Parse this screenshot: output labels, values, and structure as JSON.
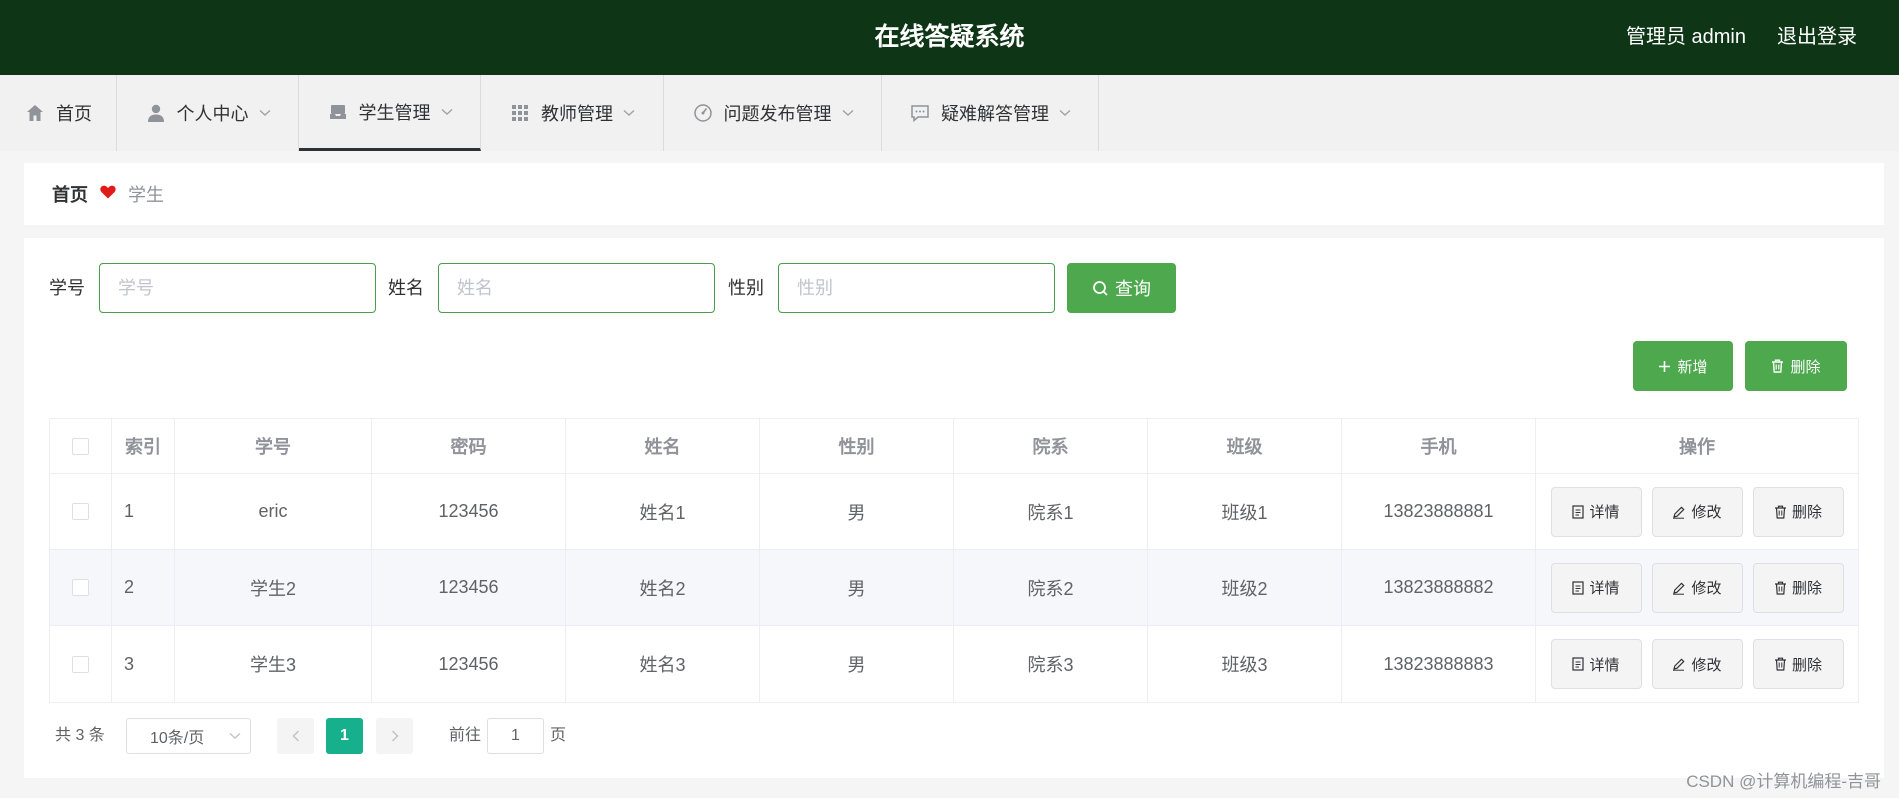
{
  "header": {
    "title": "在线答疑系统",
    "user": "管理员 admin",
    "logout": "退出登录"
  },
  "menu": [
    {
      "label": "首页",
      "icon": "home-icon"
    },
    {
      "label": "个人中心",
      "icon": "user-icon"
    },
    {
      "label": "学生管理",
      "icon": "inbox-icon",
      "active": true
    },
    {
      "label": "教师管理",
      "icon": "grid-icon"
    },
    {
      "label": "问题发布管理",
      "icon": "gauge-icon"
    },
    {
      "label": "疑难解答管理",
      "icon": "chat-icon"
    }
  ],
  "breadcrumb": {
    "home": "首页",
    "current": "学生"
  },
  "search": {
    "fields": [
      {
        "label": "学号",
        "placeholder": "学号"
      },
      {
        "label": "姓名",
        "placeholder": "姓名"
      },
      {
        "label": "性别",
        "placeholder": "性别"
      }
    ],
    "query": "查询"
  },
  "actions": {
    "add": "新增",
    "delete": "删除"
  },
  "table": {
    "columns": [
      "索引",
      "学号",
      "密码",
      "姓名",
      "性别",
      "院系",
      "班级",
      "手机",
      "操作"
    ],
    "rows": [
      {
        "index": "1",
        "no": "eric",
        "pwd": "123456",
        "name": "姓名1",
        "gender": "男",
        "dept": "院系1",
        "cls": "班级1",
        "phone": "13823888881"
      },
      {
        "index": "2",
        "no": "学生2",
        "pwd": "123456",
        "name": "姓名2",
        "gender": "男",
        "dept": "院系2",
        "cls": "班级2",
        "phone": "13823888882"
      },
      {
        "index": "3",
        "no": "学生3",
        "pwd": "123456",
        "name": "姓名3",
        "gender": "男",
        "dept": "院系3",
        "cls": "班级3",
        "phone": "13823888883"
      }
    ],
    "ops": {
      "detail": "详情",
      "edit": "修改",
      "del": "删除"
    }
  },
  "pagination": {
    "total": "共 3 条",
    "page_size": "10条/页",
    "current": "1",
    "goto_prefix": "前往",
    "goto_value": "1",
    "goto_suffix": "页"
  },
  "watermark": "CSDN @计算机编程-吉哥",
  "colors": {
    "header_bg": "#0d3516",
    "primary_green": "#4ea94e",
    "page_active": "#16b08c",
    "heart": "#e01b1b"
  }
}
